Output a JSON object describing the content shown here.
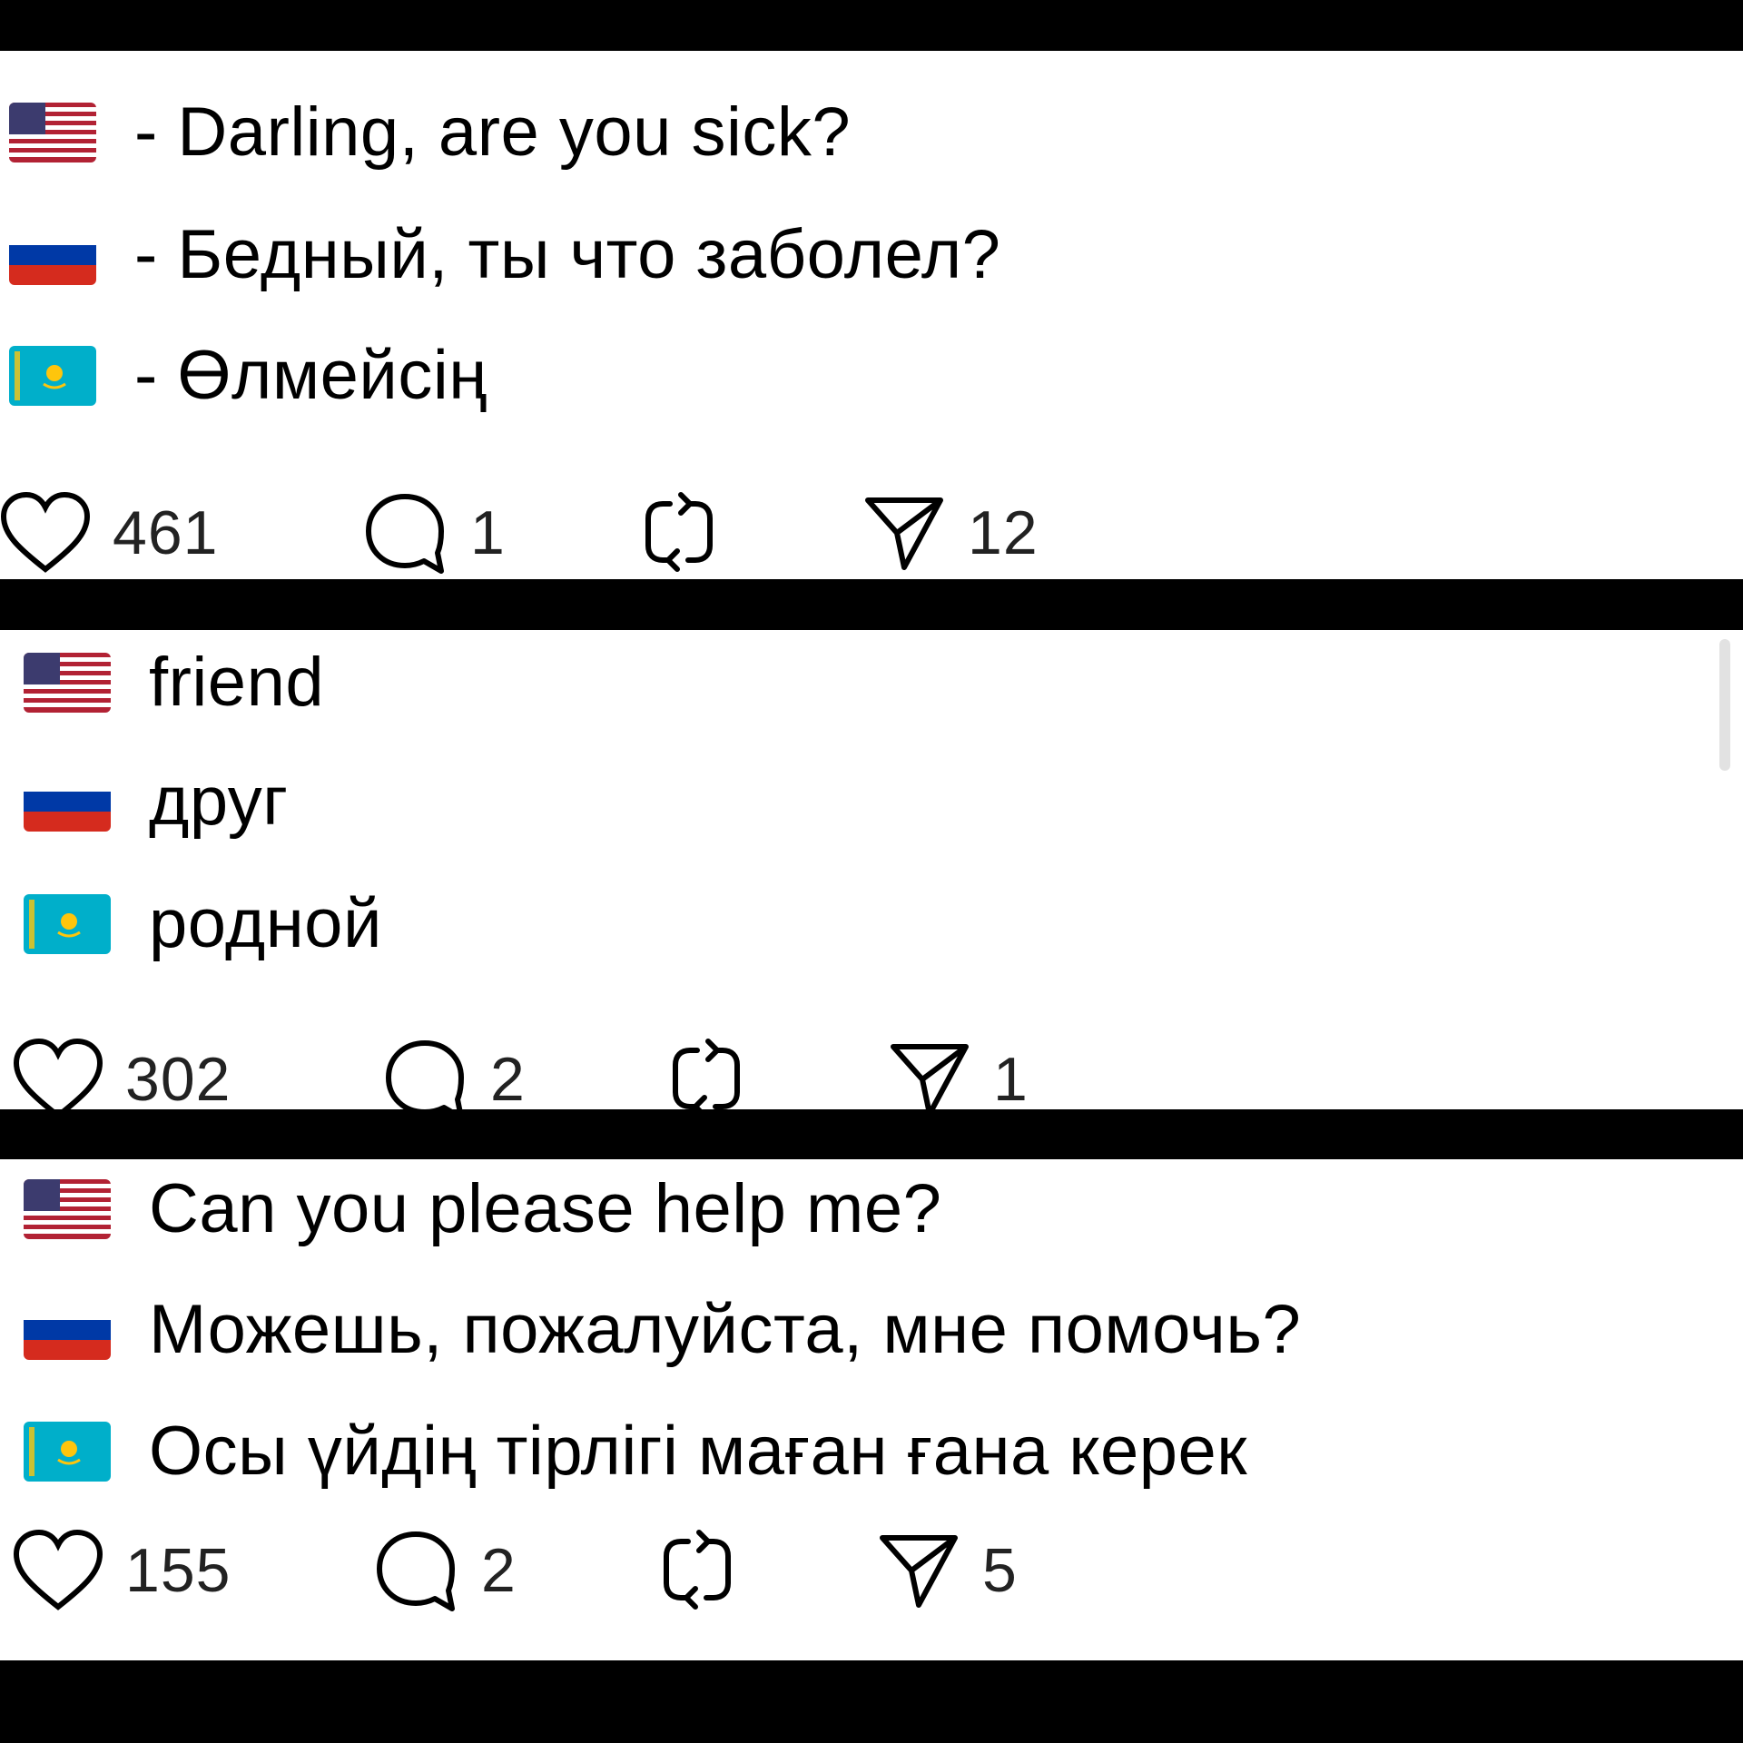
{
  "posts": [
    {
      "lines": [
        {
          "flag": "us-flag",
          "text": "- Darling, are you sick?"
        },
        {
          "flag": "ru-flag",
          "text": "- Бедный, ты что заболел?"
        },
        {
          "flag": "kz-flag",
          "text": "- Өлмейсің"
        }
      ],
      "actions": {
        "likes": "461",
        "comments": "1",
        "reposts": "",
        "shares": "12"
      }
    },
    {
      "lines": [
        {
          "flag": "us-flag",
          "text": "friend"
        },
        {
          "flag": "ru-flag",
          "text": "друг"
        },
        {
          "flag": "kz-flag",
          "text": "родной"
        }
      ],
      "actions": {
        "likes": "302",
        "comments": "2",
        "reposts": "",
        "shares": "1"
      }
    },
    {
      "lines": [
        {
          "flag": "us-flag",
          "text": "Can you please help me?"
        },
        {
          "flag": "ru-flag",
          "text": "Можешь, пожалуйста, мне помочь?"
        },
        {
          "flag": "kz-flag",
          "text": "Осы үйдің тірлігі маған ғана керек"
        }
      ],
      "actions": {
        "likes": "155",
        "comments": "2",
        "reposts": "",
        "shares": "5"
      }
    }
  ],
  "icons": {
    "like": "heart-icon",
    "comment": "comment-bubble-icon",
    "repost": "repost-icon",
    "share": "send-icon"
  },
  "colors": {
    "background": "#ffffff",
    "separator": "#000000",
    "text": "#000000",
    "kz_flag": "#00AFCA",
    "kz_sun": "#FEC50C",
    "us_red": "#B22234",
    "us_blue": "#3C3B6E",
    "ru_blue": "#0039A6",
    "ru_red": "#D52B1E"
  }
}
